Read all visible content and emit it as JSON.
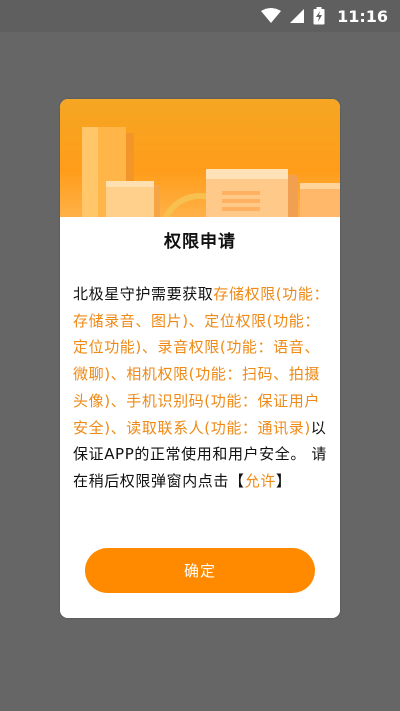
{
  "status_bar": {
    "time": "11:16",
    "icons": [
      "wifi-icon",
      "signal-icon",
      "battery-charging-icon"
    ]
  },
  "dialog": {
    "title": "权限申请",
    "message": {
      "intro": "北极星守护需要获取",
      "perm_storage": "存储权限(功能：存储录音、图片)",
      "sep1": "、",
      "perm_location": "定位权限(功能：定位功能)",
      "sep2": "、",
      "perm_record": "录音权限(功能：语音、微聊)",
      "sep3": "、",
      "perm_camera": "相机权限(功能：扫码、拍摄头像)",
      "sep4": "、",
      "perm_device": "手机识别码(功能：保证用户安全)",
      "sep5": "、",
      "perm_contacts": "读取联系人(功能：通讯录)",
      "outro": "以保证APP的正常使用和用户安全。 请在稍后权限弹窗内点击【",
      "allow": "允许",
      "close_bracket": "】"
    },
    "confirm_label": "确定"
  },
  "colors": {
    "backdrop": "#666666",
    "accent": "#ff8a00",
    "highlight_text": "#ee8a17",
    "banner": "#f5a623"
  }
}
